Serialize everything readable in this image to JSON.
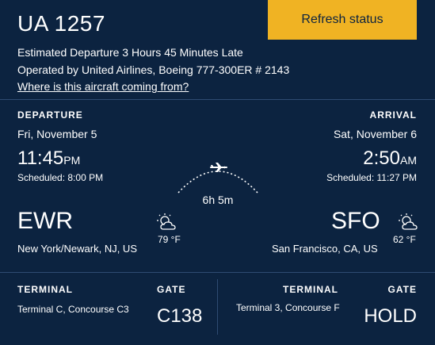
{
  "flight": {
    "number": "UA 1257",
    "refresh_label": "Refresh status",
    "estimate": "Estimated Departure 3 Hours 45 Minutes Late",
    "operated": "Operated by United Airlines, Boeing 777-300ER # 2143",
    "origin_link": "Where is this aircraft coming from?"
  },
  "departure": {
    "heading": "DEPARTURE",
    "date": "Fri, November 5",
    "time": "11:45",
    "ampm": "PM",
    "scheduled": "Scheduled: 8:00 PM",
    "code": "EWR",
    "city": "New York/Newark, NJ, US",
    "temp": "79 °F",
    "weather_icon": "partly-cloudy-icon",
    "terminal_heading": "TERMINAL",
    "terminal": "Terminal C, Concourse C3",
    "gate_heading": "GATE",
    "gate": "C138"
  },
  "arrival": {
    "heading": "ARRIVAL",
    "date": "Sat, November 6",
    "time": "2:50",
    "ampm": "AM",
    "scheduled": "Scheduled: 11:27 PM",
    "code": "SFO",
    "city": "San Francisco, CA, US",
    "temp": "62 °F",
    "weather_icon": "partly-cloudy-icon",
    "terminal_heading": "TERMINAL",
    "terminal": "Terminal 3, Concourse F",
    "gate_heading": "GATE",
    "gate": "HOLD"
  },
  "duration": "6h 5m",
  "colors": {
    "background": "#0c2340",
    "accent": "#f0b323",
    "divider": "#2e4b72"
  }
}
